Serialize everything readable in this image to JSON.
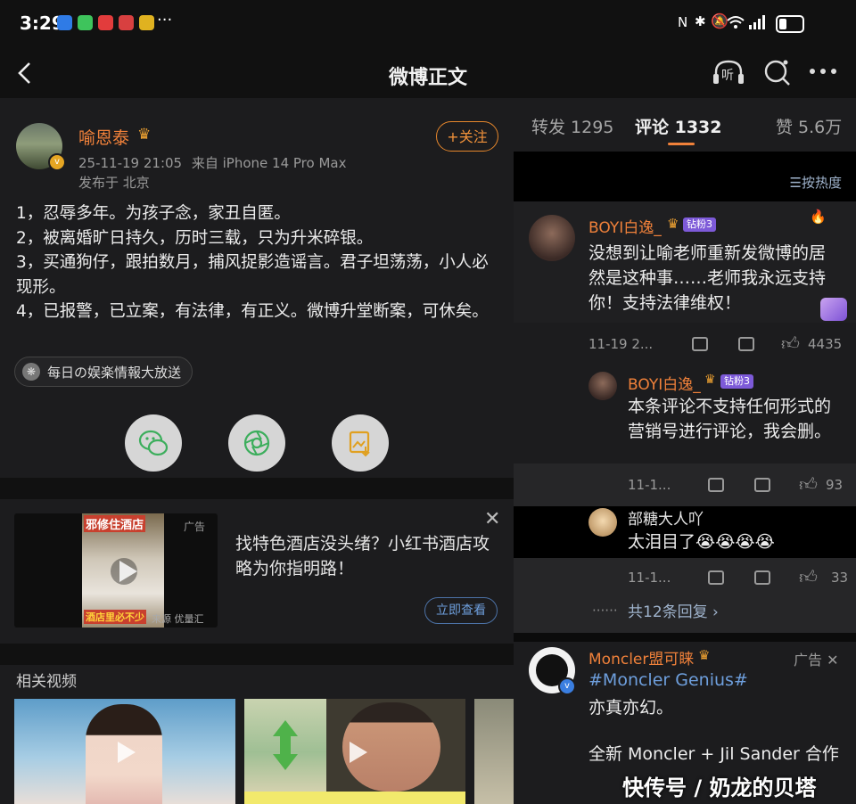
{
  "status_bar": {
    "time": "3:29",
    "more": "···"
  },
  "nav": {
    "title": "微博正文",
    "back_icon": "back-arrow-icon",
    "listen_label": "听"
  },
  "post": {
    "author": "喻恩泰",
    "timestamp": "25-11-19 21:05",
    "source": "来自 iPhone 14 Pro Max",
    "location": "发布于 北京",
    "follow_label": "+关注",
    "lines": [
      "1，忍辱多年。为孩子念，家丑自匿。",
      "2，被离婚旷日持久，历时三载，只为升米碎银。",
      "3，买通狗仔，跟拍数月，捕风捉影造谣言。君子坦荡荡，小人必现形。",
      "4，已报警，已立案，有法律，有正义。微博升堂断案，可休矣。"
    ],
    "tag": "每日の娱楽情報大放送"
  },
  "ad": {
    "label": "广告",
    "thumb_title": "邪修住酒店",
    "thumb_caption": "酒店里必不少",
    "thumb_source": "来源 优量汇",
    "text": "找特色酒店没头绪？小红书酒店攻略为你指明路！",
    "button": "立即查看"
  },
  "related": {
    "title": "相关视频"
  },
  "tabs": {
    "repost": "转发 1295",
    "comment": "评论 1332",
    "like": "赞 5.6万"
  },
  "sort_label": "按热度",
  "comments": [
    {
      "name": "BOYI白逸_",
      "badge": "钻粉3",
      "text": "没想到让喻老师重新发微博的居然是这种事……老师我永远支持你！支持法律维权！",
      "date": "11-19 2...",
      "likes": "4435"
    }
  ],
  "replies": [
    {
      "name": "BOYI白逸_",
      "badge": "钻粉3",
      "text": "本条评论不支持任何形式的营销号进行评论，我会删。",
      "date": "11-1...",
      "likes": "93"
    },
    {
      "name": "部糖大人吖",
      "text": "太泪目了😭😭😭😭",
      "date": "11-1...",
      "likes": "33"
    }
  ],
  "more_replies": "共12条回复",
  "ad_comment": {
    "name": "Moncler盟可睐",
    "label": "广告",
    "hashtag": "#Moncler Genius#",
    "line2": "亦真亦幻。",
    "line3": "全新 Moncler + Jil Sander 合作"
  },
  "watermark": "快传号 / 奶龙的贝塔",
  "colors": {
    "accent": "#f0813a",
    "link": "#6e9fdd",
    "background": "#1c1c1e"
  }
}
